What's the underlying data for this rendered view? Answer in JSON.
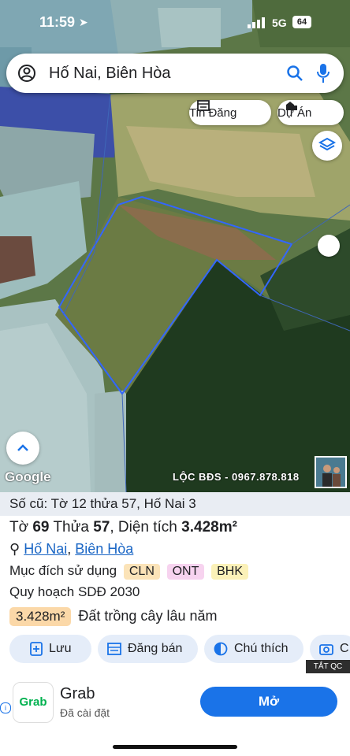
{
  "status_bar": {
    "time": "11:59",
    "network": "5G",
    "battery": "64"
  },
  "search": {
    "query": "Hố Nai, Biên Hòa"
  },
  "chips": {
    "listing": "Tin Đăng",
    "project": "Dự Án"
  },
  "map": {
    "provider": "Google",
    "watermark": "LỘC BĐS - 0967.878.818"
  },
  "parcel": {
    "old_info": "Số cũ: Tờ 12 thửa 57, Hố Nai 3",
    "sheet_label": "Tờ",
    "sheet": "69",
    "plot_label": "Thửa",
    "plot": "57",
    "area_label": ", Diện tích",
    "area": "3.428m²",
    "ward": "Hố Nai",
    "city": "Biên Hòa",
    "comma": ",",
    "purpose_label": "Mục đích sử dụng",
    "purposes": [
      "CLN",
      "ONT",
      "BHK"
    ],
    "plan_label": "Quy hoạch SDĐ 2030",
    "area_badge": "3.428m²",
    "land_type": "Đất trồng cây lâu năm"
  },
  "actions": {
    "save": "Lưu",
    "post": "Đăng bán",
    "legend": "Chú thích",
    "photo": "C"
  },
  "ad": {
    "hide_label": "TẮT QC",
    "logo_text": "Grab",
    "app_name": "Grab",
    "status": "Đã cài đặt",
    "open_button": "Mở"
  }
}
